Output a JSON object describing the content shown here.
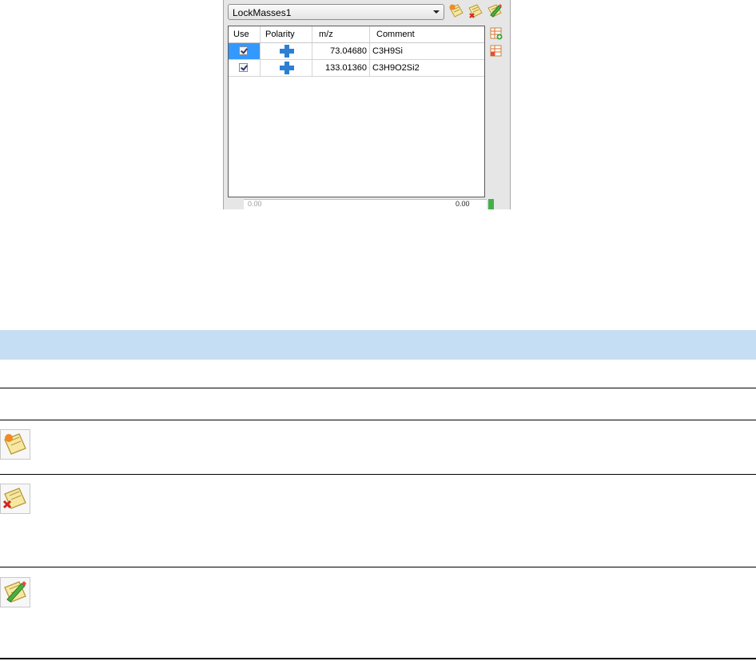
{
  "dialog": {
    "combo_value": "LockMasses1",
    "toolbar_icons": [
      "new-lockmass-list-icon",
      "delete-lockmass-list-icon",
      "edit-lockmass-list-icon"
    ],
    "columns": [
      "Use",
      "Polarity",
      "m/z",
      "Comment"
    ],
    "rows": [
      {
        "use": true,
        "polarity": "positive",
        "mz": "73.04680",
        "comment": "C3H9Si"
      },
      {
        "use": true,
        "polarity": "positive",
        "mz": "133.01360",
        "comment": "C3H9O2Si2"
      }
    ],
    "side_icons": [
      "add-row-icon",
      "delete-row-icon"
    ],
    "footer_left": "0.00",
    "footer_right": "0.00"
  },
  "doc_table": {
    "row_icons": [
      "new-list-icon",
      "delete-list-icon",
      "edit-list-icon"
    ]
  },
  "colors": {
    "header_band": "#c6def3",
    "selection": "#3399ff",
    "polarity_plus": "#2e7fd4"
  }
}
